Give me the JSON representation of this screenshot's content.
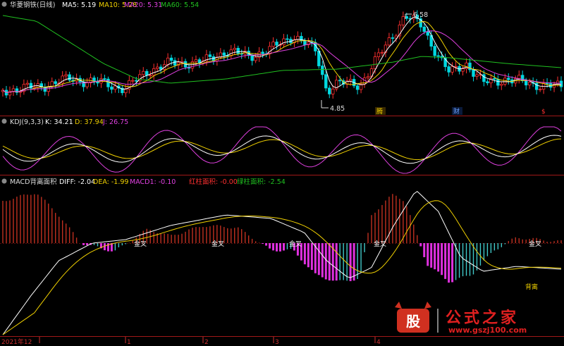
{
  "top_panel": {
    "title": "华菱钢铁(日线)",
    "ma_items": [
      {
        "label": "MA5: 5.19",
        "color": "#ffffff"
      },
      {
        "label": "MA10: 5.28",
        "color": "#f0d000"
      },
      {
        "label": "MA20: 5.31",
        "color": "#e040e0"
      },
      {
        "label": "MA60: 5.54",
        "color": "#20c020"
      }
    ],
    "high_label": "6.58",
    "low_label": "4.85",
    "markers": [
      {
        "text": "腾",
        "color": "#f0d000"
      },
      {
        "text": "财",
        "color": "#6aa0ff"
      },
      {
        "text": "$",
        "color": "#ff3030"
      }
    ]
  },
  "kdj_panel": {
    "name": "KDJ(9,3,3)",
    "items": [
      {
        "label": "K: 34.21",
        "color": "#ffffff"
      },
      {
        "label": "D: 37.94",
        "color": "#f0d000"
      },
      {
        "label": "J: 26.75",
        "color": "#e040e0"
      }
    ]
  },
  "macd_panel": {
    "name": "MACD背离面积",
    "items": [
      {
        "label": "DIFF: -2.04",
        "color": "#ffffff"
      },
      {
        "label": "DEA: -1.99",
        "color": "#f0d000"
      },
      {
        "label": "MACD1: -0.10",
        "color": "#e040e0"
      },
      {
        "label": "红柱面积: -0.00",
        "color": "#ff3030"
      },
      {
        "label": "绿柱面积: -2.54",
        "color": "#20c020"
      }
    ],
    "cross_label": "金叉",
    "divergence_label": "背离"
  },
  "x_axis": {
    "labels": [
      "2021年12",
      "1",
      "2",
      "3",
      "4"
    ]
  },
  "watermark": {
    "logo_char": "股",
    "title": "公式之家",
    "url": "www.gszj100.com"
  },
  "colors": {
    "background": "#000000",
    "separator": "#a01818",
    "up": "#ff3030",
    "down": "#00d8e0",
    "ma5": "#ffffff",
    "ma10": "#f0d000",
    "ma20": "#e040e0",
    "ma60": "#20c020",
    "macd_pos": "#c03020",
    "macd_neg_cyan": "#40c8c8",
    "macd_neg_magenta": "#e030e0"
  }
}
